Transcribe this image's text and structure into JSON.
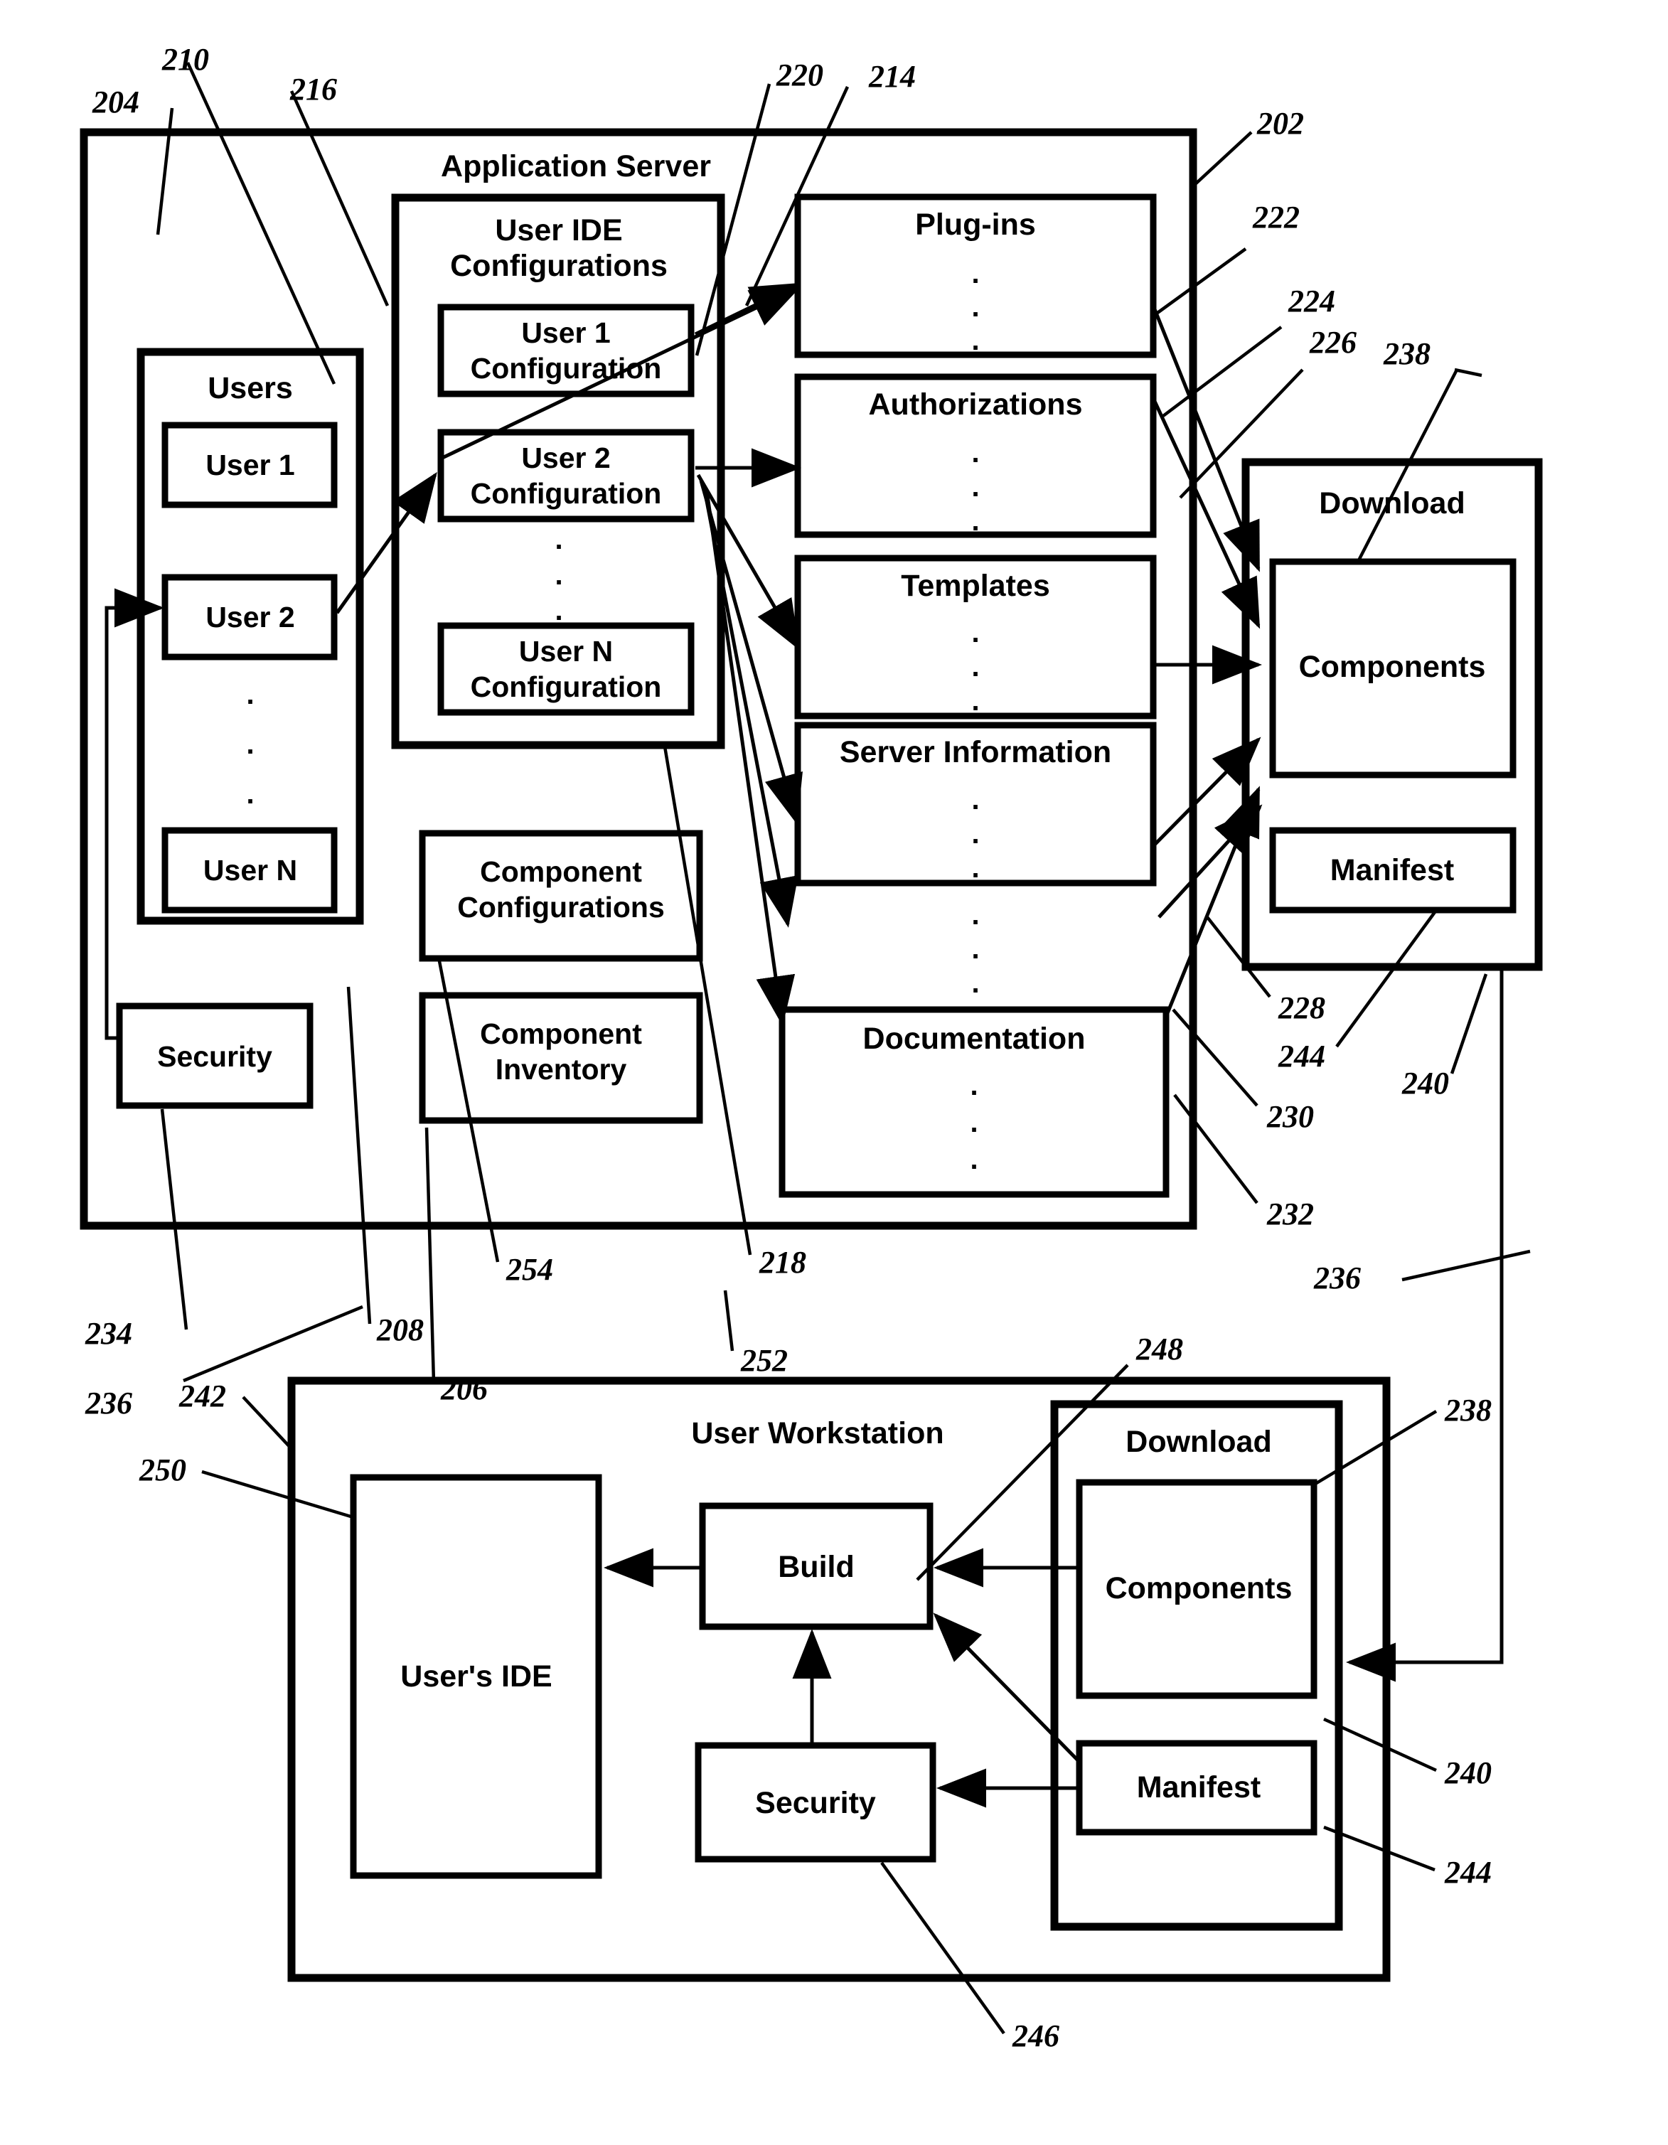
{
  "figure": {
    "type": "patent-block-diagram",
    "vertical_ellipsis": "."
  },
  "app_server": {
    "title": "Application Server",
    "ref": "202",
    "outer_refs": [
      "204",
      "210",
      "216",
      "220",
      "214",
      "202"
    ],
    "users_panel": {
      "title": "Users",
      "ref": "210",
      "items": [
        "User 1",
        "User 2",
        "User N"
      ]
    },
    "ide_configs": {
      "title_line1": "User IDE",
      "title_line2": "Configurations",
      "ref": "216",
      "items": [
        {
          "line1": "User 1",
          "line2": "Configuration"
        },
        {
          "line1": "User 2",
          "line2": "Configuration"
        },
        {
          "line1": "User N",
          "line2": "Configuration"
        }
      ]
    },
    "security": {
      "label": "Security",
      "ref": "234"
    },
    "component_configurations": {
      "line1": "Component",
      "line2": "Configurations",
      "ref": "254"
    },
    "component_inventory": {
      "line1": "Component",
      "line2": "Inventory",
      "ref": "206"
    },
    "repos": [
      {
        "label": "Plug-ins",
        "ref": "222"
      },
      {
        "label": "Authorizations",
        "ref": "224"
      },
      {
        "label": "Templates",
        "ref": "226"
      },
      {
        "label": "Server Information",
        "ref": "228"
      },
      {
        "label": "Documentation",
        "ref": "232"
      }
    ],
    "download": {
      "title": "Download",
      "ref": "238",
      "components": {
        "label": "Components",
        "ref": "240"
      },
      "manifest": {
        "label": "Manifest",
        "ref": "244"
      }
    }
  },
  "workstation": {
    "title": "User Workstation",
    "ref": "242",
    "users_ide": {
      "label": "User's IDE",
      "ref": "250"
    },
    "build": {
      "label": "Build",
      "ref": "248"
    },
    "security": {
      "label": "Security",
      "ref": "246"
    },
    "download": {
      "title": "Download",
      "ref": "238",
      "components": {
        "label": "Components",
        "ref": "240"
      },
      "manifest": {
        "label": "Manifest",
        "ref": "244"
      }
    }
  },
  "reference_numerals": [
    {
      "id": "r204",
      "text": "204"
    },
    {
      "id": "r210",
      "text": "210"
    },
    {
      "id": "r216",
      "text": "216"
    },
    {
      "id": "r220",
      "text": "220"
    },
    {
      "id": "r214",
      "text": "214"
    },
    {
      "id": "r202",
      "text": "202"
    },
    {
      "id": "r222",
      "text": "222"
    },
    {
      "id": "r224",
      "text": "224"
    },
    {
      "id": "r226",
      "text": "226"
    },
    {
      "id": "r238a",
      "text": "238"
    },
    {
      "id": "r228",
      "text": "228"
    },
    {
      "id": "r244a",
      "text": "244"
    },
    {
      "id": "r240a",
      "text": "240"
    },
    {
      "id": "r230",
      "text": "230"
    },
    {
      "id": "r232",
      "text": "232"
    },
    {
      "id": "r234",
      "text": "234"
    },
    {
      "id": "r236a",
      "text": "236"
    },
    {
      "id": "r208",
      "text": "208"
    },
    {
      "id": "r254",
      "text": "254"
    },
    {
      "id": "r218",
      "text": "218"
    },
    {
      "id": "r206a",
      "text": "206"
    },
    {
      "id": "r252",
      "text": "252"
    },
    {
      "id": "r236b",
      "text": "236"
    },
    {
      "id": "r242",
      "text": "242"
    },
    {
      "id": "r250",
      "text": "250"
    },
    {
      "id": "r248",
      "text": "248"
    },
    {
      "id": "r238b",
      "text": "238"
    },
    {
      "id": "r240b",
      "text": "240"
    },
    {
      "id": "r244b",
      "text": "244"
    },
    {
      "id": "r246",
      "text": "246"
    }
  ]
}
